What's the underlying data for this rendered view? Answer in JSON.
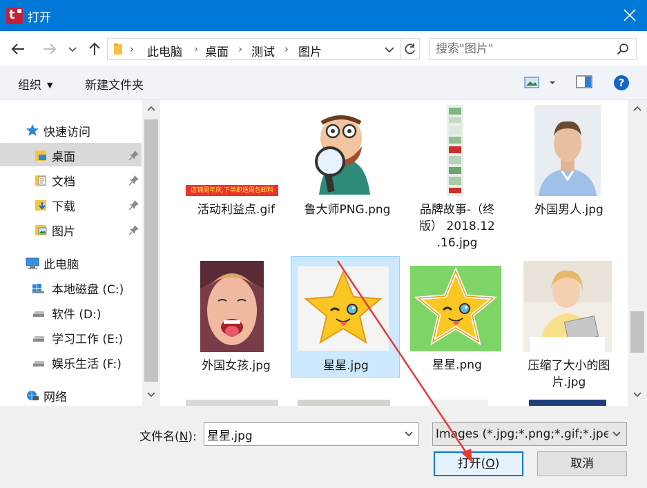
{
  "window": {
    "title": "打开",
    "close_label": "×"
  },
  "nav": {
    "breadcrumb": [
      "此电脑",
      "桌面",
      "测试",
      "图片"
    ],
    "search_placeholder": "搜索\"图片\""
  },
  "toolbar": {
    "organize_label": "组织",
    "new_folder_label": "新建文件夹"
  },
  "sidebar": {
    "items": [
      {
        "label": "快速访问",
        "icon": "star-icon"
      },
      {
        "label": "桌面",
        "icon": "desktop-folder-icon",
        "pinned": true
      },
      {
        "label": "文档",
        "icon": "documents-folder-icon",
        "pinned": true
      },
      {
        "label": "下载",
        "icon": "downloads-folder-icon",
        "pinned": true
      },
      {
        "label": "图片",
        "icon": "pictures-folder-icon",
        "pinned": true
      },
      {
        "label": "此电脑",
        "icon": "computer-icon"
      },
      {
        "label": "本地磁盘 (C:)",
        "icon": "windows-drive-icon"
      },
      {
        "label": "软件 (D:)",
        "icon": "drive-icon"
      },
      {
        "label": "学习工作 (E:)",
        "icon": "drive-icon"
      },
      {
        "label": "娱乐生活 (F:)",
        "icon": "drive-icon"
      },
      {
        "label": "网络",
        "icon": "network-icon"
      }
    ]
  },
  "files": [
    {
      "name": "活动利益点.gif",
      "thumb_text": "店铺周年庆,下单即送周包邮料"
    },
    {
      "name": "鲁大师PNG.png"
    },
    {
      "name": "品牌故事-（终版） 2018.12.16.jpg",
      "lines": [
        "品牌故事-（终",
        "版） 2018.12",
        ".16.jpg"
      ]
    },
    {
      "name": "外国男人.jpg"
    },
    {
      "name": "外国女孩.jpg"
    },
    {
      "name": "星星.jpg",
      "selected": true
    },
    {
      "name": "星星.png"
    },
    {
      "name": "压缩了大小的图片.jpg",
      "lines": [
        "压缩了大小的图",
        "片.jpg"
      ]
    }
  ],
  "bottom": {
    "filename_label": "文件名(",
    "filename_key": "N",
    "filename_label_end": "):",
    "filename_value": "星星.jpg",
    "filetype_value": "Images (*.jpg;*.png;*.gif;*.jpeg)",
    "open_label": "打开(",
    "open_key": "O",
    "open_label_end": ")",
    "cancel_label": "取消"
  },
  "colors": {
    "titlebar": "#0078d7",
    "selection": "#cce8ff",
    "annotation_arrow": "#e53935"
  }
}
